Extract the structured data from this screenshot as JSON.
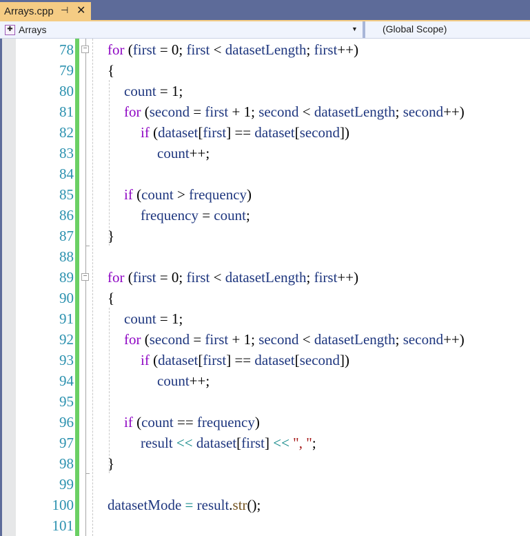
{
  "tab": {
    "title": "Arrays.cpp",
    "pin_icon": "pin-icon",
    "close_icon": "close-icon"
  },
  "navbar": {
    "project_icon": "project-icon",
    "project": "Arrays",
    "dropdown_icon": "chevron-down-icon",
    "scope": "(Global Scope)"
  },
  "editor": {
    "colors": {
      "keyword": "#8f08c4",
      "identifier": "#1f377f",
      "operator_overload": "#008080",
      "string": "#a31515",
      "function": "#74531f",
      "line_number": "#2b91af",
      "change_bar": "#6bd064"
    },
    "lines": [
      {
        "n": "78",
        "indent": 0,
        "tokens": [
          [
            "kw",
            "for"
          ],
          [
            "pn",
            " ("
          ],
          [
            "id",
            "first"
          ],
          [
            "pn",
            " = 0; "
          ],
          [
            "id",
            "first"
          ],
          [
            "pn",
            " < "
          ],
          [
            "id",
            "datasetLength"
          ],
          [
            "pn",
            "; "
          ],
          [
            "id",
            "first"
          ],
          [
            "pn",
            "++)"
          ]
        ]
      },
      {
        "n": "79",
        "indent": 0,
        "tokens": [
          [
            "pn",
            "{"
          ]
        ]
      },
      {
        "n": "80",
        "indent": 1,
        "tokens": [
          [
            "id",
            "count"
          ],
          [
            "pn",
            " = 1;"
          ]
        ]
      },
      {
        "n": "81",
        "indent": 1,
        "tokens": [
          [
            "kw",
            "for"
          ],
          [
            "pn",
            " ("
          ],
          [
            "id",
            "second"
          ],
          [
            "pn",
            " = "
          ],
          [
            "id",
            "first"
          ],
          [
            "pn",
            " + 1; "
          ],
          [
            "id",
            "second"
          ],
          [
            "pn",
            " < "
          ],
          [
            "id",
            "datasetLength"
          ],
          [
            "pn",
            "; "
          ],
          [
            "id",
            "second"
          ],
          [
            "pn",
            "++)"
          ]
        ]
      },
      {
        "n": "82",
        "indent": 2,
        "tokens": [
          [
            "kw",
            "if"
          ],
          [
            "pn",
            " ("
          ],
          [
            "id",
            "dataset"
          ],
          [
            "pn",
            "["
          ],
          [
            "id",
            "first"
          ],
          [
            "pn",
            "] == "
          ],
          [
            "id",
            "dataset"
          ],
          [
            "pn",
            "["
          ],
          [
            "id",
            "second"
          ],
          [
            "pn",
            "])"
          ]
        ]
      },
      {
        "n": "83",
        "indent": 3,
        "tokens": [
          [
            "id",
            "count"
          ],
          [
            "pn",
            "++;"
          ]
        ]
      },
      {
        "n": "84",
        "indent": 0,
        "tokens": []
      },
      {
        "n": "85",
        "indent": 1,
        "tokens": [
          [
            "kw",
            "if"
          ],
          [
            "pn",
            " ("
          ],
          [
            "id",
            "count"
          ],
          [
            "pn",
            " > "
          ],
          [
            "id",
            "frequency"
          ],
          [
            "pn",
            ")"
          ]
        ]
      },
      {
        "n": "86",
        "indent": 2,
        "tokens": [
          [
            "id",
            "frequency"
          ],
          [
            "pn",
            " = "
          ],
          [
            "id",
            "count"
          ],
          [
            "pn",
            ";"
          ]
        ]
      },
      {
        "n": "87",
        "indent": 0,
        "tokens": [
          [
            "pn",
            "}"
          ]
        ]
      },
      {
        "n": "88",
        "indent": 0,
        "tokens": []
      },
      {
        "n": "89",
        "indent": 0,
        "tokens": [
          [
            "kw",
            "for"
          ],
          [
            "pn",
            " ("
          ],
          [
            "id",
            "first"
          ],
          [
            "pn",
            " = 0; "
          ],
          [
            "id",
            "first"
          ],
          [
            "pn",
            " < "
          ],
          [
            "id",
            "datasetLength"
          ],
          [
            "pn",
            "; "
          ],
          [
            "id",
            "first"
          ],
          [
            "pn",
            "++)"
          ]
        ]
      },
      {
        "n": "90",
        "indent": 0,
        "tokens": [
          [
            "pn",
            "{"
          ]
        ]
      },
      {
        "n": "91",
        "indent": 1,
        "tokens": [
          [
            "id",
            "count"
          ],
          [
            "pn",
            " = 1;"
          ]
        ]
      },
      {
        "n": "92",
        "indent": 1,
        "tokens": [
          [
            "kw",
            "for"
          ],
          [
            "pn",
            " ("
          ],
          [
            "id",
            "second"
          ],
          [
            "pn",
            " = "
          ],
          [
            "id",
            "first"
          ],
          [
            "pn",
            " + 1; "
          ],
          [
            "id",
            "second"
          ],
          [
            "pn",
            " < "
          ],
          [
            "id",
            "datasetLength"
          ],
          [
            "pn",
            "; "
          ],
          [
            "id",
            "second"
          ],
          [
            "pn",
            "++)"
          ]
        ]
      },
      {
        "n": "93",
        "indent": 2,
        "tokens": [
          [
            "kw",
            "if"
          ],
          [
            "pn",
            " ("
          ],
          [
            "id",
            "dataset"
          ],
          [
            "pn",
            "["
          ],
          [
            "id",
            "first"
          ],
          [
            "pn",
            "] == "
          ],
          [
            "id",
            "dataset"
          ],
          [
            "pn",
            "["
          ],
          [
            "id",
            "second"
          ],
          [
            "pn",
            "])"
          ]
        ]
      },
      {
        "n": "94",
        "indent": 3,
        "tokens": [
          [
            "id",
            "count"
          ],
          [
            "pn",
            "++;"
          ]
        ]
      },
      {
        "n": "95",
        "indent": 0,
        "tokens": []
      },
      {
        "n": "96",
        "indent": 1,
        "tokens": [
          [
            "kw",
            "if"
          ],
          [
            "pn",
            " ("
          ],
          [
            "id",
            "count"
          ],
          [
            "pn",
            " == "
          ],
          [
            "id",
            "frequency"
          ],
          [
            "pn",
            ")"
          ]
        ]
      },
      {
        "n": "97",
        "indent": 2,
        "tokens": [
          [
            "id",
            "result"
          ],
          [
            "op",
            " << "
          ],
          [
            "id",
            "dataset"
          ],
          [
            "pn",
            "["
          ],
          [
            "id",
            "first"
          ],
          [
            "pn",
            "]"
          ],
          [
            "op",
            " << "
          ],
          [
            "str",
            "\", \""
          ],
          [
            "pn",
            ";"
          ]
        ]
      },
      {
        "n": "98",
        "indent": 0,
        "tokens": [
          [
            "pn",
            "}"
          ]
        ]
      },
      {
        "n": "99",
        "indent": 0,
        "tokens": []
      },
      {
        "n": "100",
        "indent": 0,
        "tokens": [
          [
            "id",
            "datasetMode"
          ],
          [
            "op",
            " = "
          ],
          [
            "id",
            "result"
          ],
          [
            "pn",
            "."
          ],
          [
            "fn",
            "str"
          ],
          [
            "pn",
            "();"
          ]
        ]
      },
      {
        "n": "101",
        "indent": 0,
        "tokens": []
      }
    ]
  }
}
